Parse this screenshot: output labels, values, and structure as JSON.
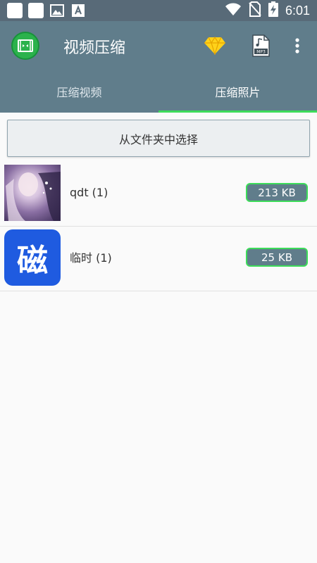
{
  "status_bar": {
    "time": "6:01",
    "icons": [
      "notification-square-icon",
      "notification-square-icon",
      "image-icon",
      "text-a-icon",
      "wifi-icon",
      "no-sim-icon",
      "battery-charging-icon"
    ]
  },
  "app_bar": {
    "title": "视频压缩",
    "icons": [
      "app-logo-icon",
      "vip-diamond-icon",
      "mp3-file-icon",
      "more-vert-icon"
    ]
  },
  "tabs": [
    {
      "label": "压缩视频",
      "active": false
    },
    {
      "label": "压缩照片",
      "active": true
    }
  ],
  "select_button": {
    "label": "从文件夹中选择"
  },
  "items": [
    {
      "name": "qdt (1)",
      "size": "213 KB"
    },
    {
      "name": "临时 (1)",
      "size": "25 KB"
    }
  ],
  "thumb2_glyph": "磁",
  "colors": {
    "primary": "#607d8b",
    "status_bar": "#586a78",
    "accent": "#3ddc5a",
    "background": "#fafafa"
  }
}
